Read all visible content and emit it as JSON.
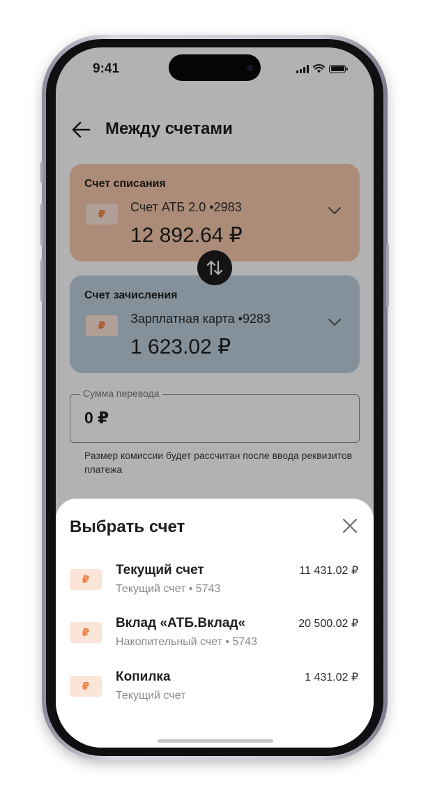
{
  "status_bar": {
    "time": "9:41"
  },
  "header": {
    "title": "Между счетами"
  },
  "debit_card": {
    "label": "Счет списания",
    "currency_icon": "₽",
    "account_name": "Счет АТБ 2.0 •2983",
    "balance": "12 892.64 ₽"
  },
  "credit_card": {
    "label": "Счет зачисления",
    "currency_icon": "₽",
    "account_name": "Зарплатная карта •9283",
    "balance": "1 623.02 ₽"
  },
  "amount_field": {
    "label": "Сумма перевода",
    "value": "0 ₽"
  },
  "commission_hint": "Размер комиссии будет рассчитан после ввода реквизитов платежа",
  "sheet": {
    "title": "Выбрать счет",
    "items": [
      {
        "icon": "₽",
        "name": "Текущий счет",
        "subtitle": "Текущий счет • 5743",
        "amount": "11 431.02 ₽"
      },
      {
        "icon": "₽",
        "name": "Вклад «АТБ.Вклад«",
        "subtitle": "Накопительный счет • 5743",
        "amount": "20 500.02 ₽"
      },
      {
        "icon": "₽",
        "name": "Копилка",
        "subtitle": "Текущий счет",
        "amount": "1 431.02 ₽"
      }
    ]
  },
  "colors": {
    "accent": "#f07b3c",
    "debit_card_bg": "#f7c9ad",
    "credit_card_bg": "#bdd0de",
    "icon_badge_bg": "#fbe4d8"
  },
  "icons": {
    "back": "arrow-left-icon",
    "swap": "swap-vertical-icon",
    "expand": "chevron-down-icon",
    "close": "close-icon",
    "currency": "ruble-icon"
  }
}
